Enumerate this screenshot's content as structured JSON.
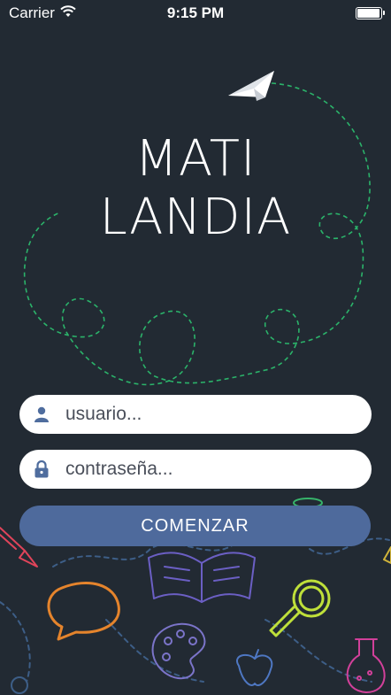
{
  "status_bar": {
    "carrier": "Carrier",
    "time": "9:15 PM",
    "wifi_icon": "wifi-icon",
    "battery_icon": "battery-icon",
    "battery_level": 0.95
  },
  "app": {
    "title_line1": "MATI",
    "title_line2": "LANDIA"
  },
  "login": {
    "username_placeholder": "usuario...",
    "username_value": "",
    "username_icon": "user-icon",
    "password_placeholder": "contraseña...",
    "password_value": "",
    "password_icon": "lock-icon",
    "submit_label": "COMENZAR"
  },
  "colors": {
    "background": "#222a33",
    "button": "#4e6a9c",
    "dashed_path": "#2bb36a",
    "field_icon": "#4f6d9e"
  }
}
